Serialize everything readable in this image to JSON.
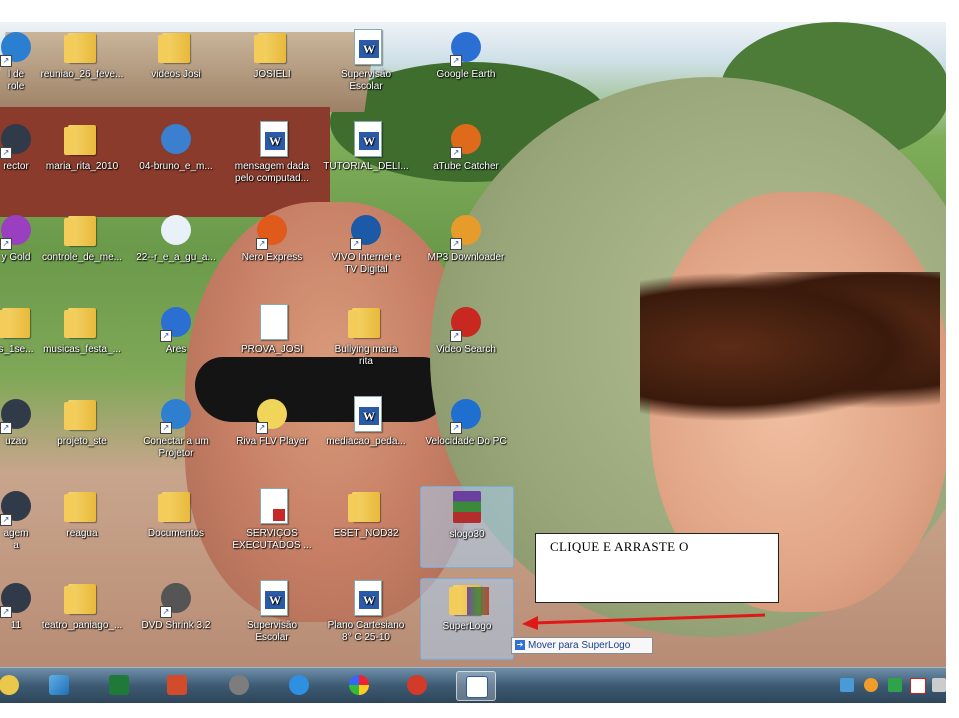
{
  "desktop": {
    "icons": [
      {
        "label": "l de\nrole",
        "kind": "shortcut-blue"
      },
      {
        "label": "reuniao_26_feve...",
        "kind": "folder"
      },
      {
        "label": "videos Josi",
        "kind": "folder"
      },
      {
        "label": "JOSIELI",
        "kind": "folder"
      },
      {
        "label": "Supervisão\nEscolar",
        "kind": "word"
      },
      {
        "label": "Google Earth",
        "kind": "globe"
      },
      {
        "label": "rector",
        "kind": "shortcut-dark"
      },
      {
        "label": "maria_rita_2010",
        "kind": "folder"
      },
      {
        "label": "04-bruno_e_m...",
        "kind": "mp3"
      },
      {
        "label": "mensagem dada\npelo computad...",
        "kind": "word"
      },
      {
        "label": "TUTORIAL_DELI...",
        "kind": "word"
      },
      {
        "label": "aTube Catcher",
        "kind": "atube"
      },
      {
        "label": "y Gold",
        "kind": "shortcut-purple"
      },
      {
        "label": "controle_de_me...",
        "kind": "folder"
      },
      {
        "label": "22--r_e_a_gu_a...",
        "kind": "image"
      },
      {
        "label": "Nero Express",
        "kind": "nero"
      },
      {
        "label": "VIVO Internet e\nTV Digital",
        "kind": "vivo"
      },
      {
        "label": "MP3 Downloader",
        "kind": "mp3dl"
      },
      {
        "label": "s_1se...",
        "kind": "folder"
      },
      {
        "label": "musicas_festa_...",
        "kind": "folder"
      },
      {
        "label": "Ares",
        "kind": "ares"
      },
      {
        "label": "PROVA_JOSI",
        "kind": "doc"
      },
      {
        "label": "Bullying maria\nrita",
        "kind": "folder"
      },
      {
        "label": "Video Search",
        "kind": "youtube"
      },
      {
        "label": "uzao",
        "kind": "shortcut-dark"
      },
      {
        "label": "projeto_ste",
        "kind": "folder"
      },
      {
        "label": "Conectar a um\nProjetor",
        "kind": "projector"
      },
      {
        "label": "Riva FLV Player",
        "kind": "riva"
      },
      {
        "label": "mediacao_peda...",
        "kind": "word"
      },
      {
        "label": "Velocidade Do PC",
        "kind": "speed"
      },
      {
        "label": "agem\na",
        "kind": "shortcut-dark"
      },
      {
        "label": "reagua",
        "kind": "folder"
      },
      {
        "label": "Documentos",
        "kind": "folder"
      },
      {
        "label": "SERVIÇOS\nEXECUTADOS ...",
        "kind": "pdf"
      },
      {
        "label": "ESET_NOD32",
        "kind": "folder"
      },
      {
        "label": "slogo30",
        "kind": "winrar"
      },
      {
        "label": "11",
        "kind": "shortcut-dark"
      },
      {
        "label": "teatro_paniago_...",
        "kind": "folder"
      },
      {
        "label": "DVD Shrink 3.2",
        "kind": "dvd"
      },
      {
        "label": "Supervisão\nEscolar",
        "kind": "word"
      },
      {
        "label": "Plano Cartesiano\n8° C 25-10",
        "kind": "word"
      },
      {
        "label": "SuperLogo",
        "kind": "folder-drag"
      }
    ]
  },
  "annotation": {
    "note_text": "CLIQUE E ARRASTE O",
    "tooltip_text": "Mover para SuperLogo",
    "arrow_color": "#e01818"
  },
  "taskbar": {
    "items": [
      "start-orb",
      "explorer",
      "excel",
      "powerpoint",
      "chrome-like",
      "internet-explorer",
      "picasa",
      "ccleaner",
      "word"
    ],
    "tray": [
      "network-icon",
      "clock-icon",
      "security-icon",
      "flag-icon",
      "volume-icon"
    ]
  },
  "colors": {
    "taskbar": "#3e5b74",
    "selection": "#aacdf0",
    "folder": "#f1c54a",
    "word_blue": "#2a5aa8"
  }
}
